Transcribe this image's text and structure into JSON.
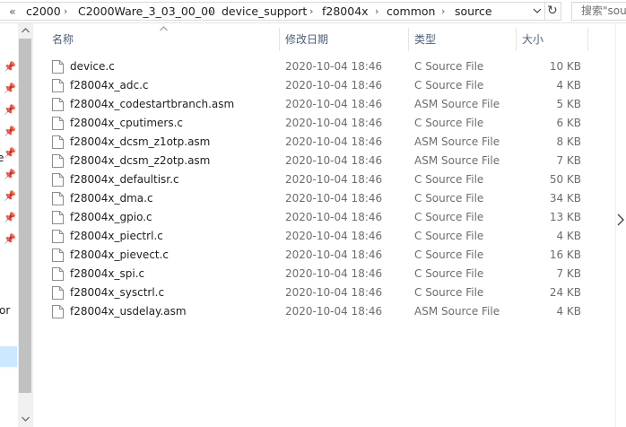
{
  "address": {
    "overflow_marker": "«",
    "crumbs": [
      "c2000",
      "C2000Ware_3_03_00_00",
      "device_support",
      "f28004x",
      "common",
      "source"
    ],
    "refresh_glyph": "↻"
  },
  "search": {
    "placeholder": "搜索\"sou"
  },
  "nav": {
    "fragments": [
      "e",
      "or"
    ]
  },
  "columns": {
    "name": "名称",
    "modified": "修改日期",
    "type": "类型",
    "size": "大小"
  },
  "files": [
    {
      "name": "device.c",
      "modified": "2020-10-04 18:46",
      "type": "C Source File",
      "size": "10 KB"
    },
    {
      "name": "f28004x_adc.c",
      "modified": "2020-10-04 18:46",
      "type": "C Source File",
      "size": "4 KB"
    },
    {
      "name": "f28004x_codestartbranch.asm",
      "modified": "2020-10-04 18:46",
      "type": "ASM Source File",
      "size": "5 KB"
    },
    {
      "name": "f28004x_cputimers.c",
      "modified": "2020-10-04 18:46",
      "type": "C Source File",
      "size": "6 KB"
    },
    {
      "name": "f28004x_dcsm_z1otp.asm",
      "modified": "2020-10-04 18:46",
      "type": "ASM Source File",
      "size": "8 KB"
    },
    {
      "name": "f28004x_dcsm_z2otp.asm",
      "modified": "2020-10-04 18:46",
      "type": "ASM Source File",
      "size": "7 KB"
    },
    {
      "name": "f28004x_defaultisr.c",
      "modified": "2020-10-04 18:46",
      "type": "C Source File",
      "size": "50 KB"
    },
    {
      "name": "f28004x_dma.c",
      "modified": "2020-10-04 18:46",
      "type": "C Source File",
      "size": "34 KB"
    },
    {
      "name": "f28004x_gpio.c",
      "modified": "2020-10-04 18:46",
      "type": "C Source File",
      "size": "13 KB"
    },
    {
      "name": "f28004x_piectrl.c",
      "modified": "2020-10-04 18:46",
      "type": "C Source File",
      "size": "4 KB"
    },
    {
      "name": "f28004x_pievect.c",
      "modified": "2020-10-04 18:46",
      "type": "C Source File",
      "size": "16 KB"
    },
    {
      "name": "f28004x_spi.c",
      "modified": "2020-10-04 18:46",
      "type": "C Source File",
      "size": "7 KB"
    },
    {
      "name": "f28004x_sysctrl.c",
      "modified": "2020-10-04 18:46",
      "type": "C Source File",
      "size": "24 KB"
    },
    {
      "name": "f28004x_usdelay.asm",
      "modified": "2020-10-04 18:46",
      "type": "ASM Source File",
      "size": "4 KB"
    }
  ],
  "colors": {
    "header_text": "#4c607a",
    "selection": "#cce8ff",
    "scroll_thumb": "#c1c1c1"
  }
}
